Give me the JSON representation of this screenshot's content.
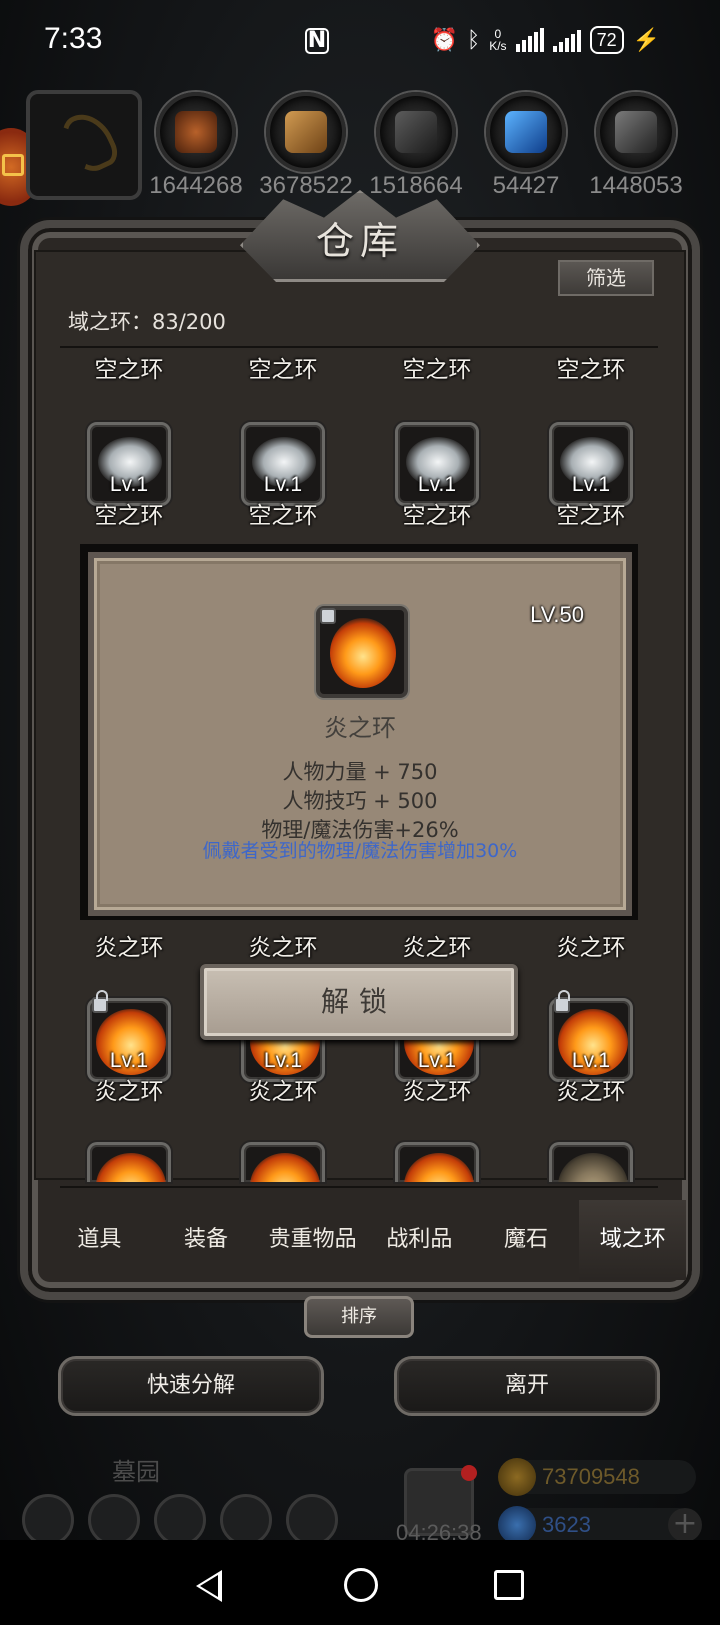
{
  "status_bar": {
    "time": "7:33",
    "nfc": "N",
    "net_speed_top": "0",
    "net_speed_unit": "K/s",
    "battery": "72"
  },
  "resources": [
    {
      "count": "1644268",
      "icon": "meat-icon"
    },
    {
      "count": "3678522",
      "icon": "wood-icon"
    },
    {
      "count": "1518664",
      "icon": "stone-icon"
    },
    {
      "count": "54427",
      "icon": "crystal-icon"
    },
    {
      "count": "1448053",
      "icon": "iron-icon"
    }
  ],
  "warehouse": {
    "title": "仓库",
    "filter_label": "筛选",
    "capacity_label": "域之环：83/200"
  },
  "items": {
    "row0_names": [
      "空之环",
      "空之环",
      "空之环",
      "空之环"
    ],
    "row1": [
      {
        "level": "Lv.1",
        "name": "空之环"
      },
      {
        "level": "Lv.1",
        "name": "空之环"
      },
      {
        "level": "Lv.1",
        "name": "空之环"
      },
      {
        "level": "Lv.1",
        "name": "空之环"
      }
    ],
    "row2_names": [
      "炎之环",
      "炎之环",
      "炎之环",
      "炎之环"
    ],
    "row3": [
      {
        "level": "Lv.1",
        "name": "炎之环"
      },
      {
        "level": "Lv.1",
        "name": "炎之环"
      },
      {
        "level": "Lv.1",
        "name": "炎之环"
      },
      {
        "level": "Lv.1",
        "name": "炎之环"
      }
    ]
  },
  "popup": {
    "level": "LV.50",
    "name": "炎之环",
    "stats": [
      "人物力量 + 750",
      "人物技巧 + 500",
      "物理/魔法伤害+26%"
    ],
    "note": "佩戴者受到的物理/魔法伤害增加30%",
    "note_color": "#3e67c9"
  },
  "unlock_label": "解锁",
  "tabs": [
    "道具",
    "装备",
    "贵重物品",
    "战利品",
    "魔石",
    "域之环"
  ],
  "active_tab": "域之环",
  "sort_label": "排序",
  "buttons": {
    "quick_decompose": "快速分解",
    "leave": "离开"
  },
  "hud": {
    "area_name": "墓园",
    "timer": "04:26:38",
    "gold": "73709548",
    "gems": "3623",
    "plus": "+"
  }
}
